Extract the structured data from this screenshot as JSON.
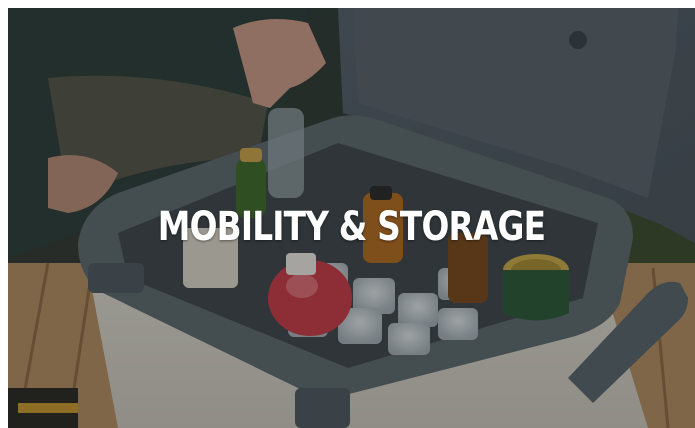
{
  "tile": {
    "caption": "MOBILITY & STORAGE"
  },
  "colors": {
    "overlay_text": "#ffffff",
    "cooler_body": "#ddd9cf",
    "cooler_trim": "#5f6a6e",
    "table_wood": "#b89366"
  }
}
